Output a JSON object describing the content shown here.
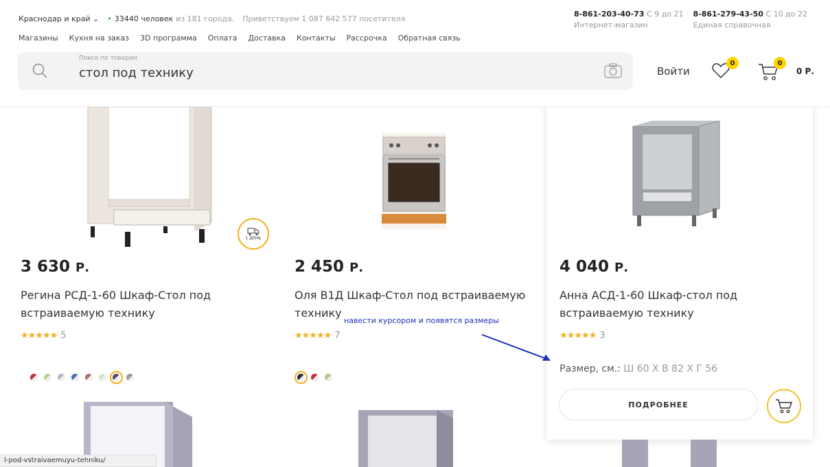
{
  "header": {
    "region": "Краснодар и край",
    "people_count": "33440 человек",
    "people_suffix": "из 181 города.",
    "welcome": "Приветствуем 1 087 642 577 посетителя",
    "nav": [
      "Магазины",
      "Кухня на заказ",
      "3D программа",
      "Оплата",
      "Доставка",
      "Контакты",
      "Рассрочка",
      "Обратная связь"
    ],
    "phones": [
      {
        "number": "8-861-203-40-73",
        "hours": "С 9 до 21",
        "label": "Интернет-магазин"
      },
      {
        "number": "8-861-279-43-50",
        "hours": "С 10 до 22",
        "label": "Единая справочная"
      }
    ],
    "search": {
      "label": "Поиск по товарам",
      "value": "стол под технику"
    },
    "login": "Войти",
    "favorites_count": "0",
    "cart_count": "0",
    "cart_total": "0 Р."
  },
  "products": [
    {
      "price": "3 630",
      "currency": "Р.",
      "title": "Регина РСД-1-60 Шкаф-Стол под встраиваемую технику",
      "stars": "★★★★★",
      "reviews": "5",
      "delivery_badge": "1 ДЕНЬ",
      "swatches": [
        "#c8323c",
        "#b8d08c",
        "#b5b8bc",
        "#4a6fb5",
        "#a0786a",
        "#d8e0c8",
        "#5a4a6a",
        "#9a9a9a"
      ]
    },
    {
      "price": "2 450",
      "currency": "Р.",
      "title": "Оля В1Д Шкаф-Стол под встраиваемую технику",
      "stars": "★★★★★",
      "reviews": "7",
      "swatches": [
        "#2a2a3a",
        "#c8323c",
        "#a8c890"
      ]
    },
    {
      "price": "4 040",
      "currency": "Р.",
      "title": "Анна АСД-1-60 Шкаф-стол под встраиваемую технику",
      "stars": "★★★★★",
      "reviews": "3",
      "size_label": "Размер, см.:",
      "size_value": "Ш 60 Х В 82 Х Г 56",
      "more_button": "ПОДРОБНЕЕ"
    }
  ],
  "annotation": "навести курсором и появятся размеры",
  "status_url": "l-pod-vstraivaemuyu-tehniku/",
  "colors": {
    "accent": "#f2b01e",
    "badge": "#ffd400",
    "annotation": "#1a2fb5"
  }
}
